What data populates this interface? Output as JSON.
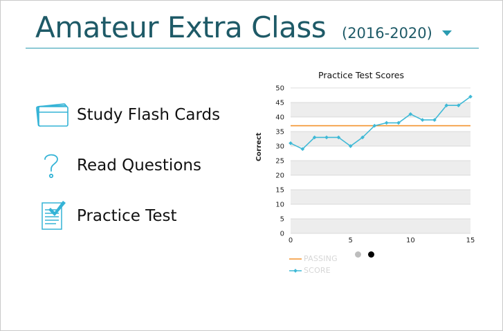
{
  "header": {
    "title": "Amateur Extra Class",
    "subtitle": "(2016-2020)",
    "dropdown_icon": "caret-down-icon",
    "accent_color": "#2a9bb0",
    "title_color": "#1e5a67"
  },
  "menu": {
    "items": [
      {
        "label": "Study Flash Cards",
        "icon": "flash-cards-icon"
      },
      {
        "label": "Read Questions",
        "icon": "question-mark-icon"
      },
      {
        "label": "Practice Test",
        "icon": "test-checklist-icon"
      }
    ],
    "icon_color": "#34b3d6"
  },
  "chart_data": {
    "type": "line",
    "title": "Practice Test Scores",
    "xlabel": "",
    "ylabel": "Correct",
    "xlim": [
      0,
      15
    ],
    "ylim": [
      0,
      50
    ],
    "x_ticks": [
      0,
      5,
      10,
      15
    ],
    "y_ticks": [
      0,
      5,
      10,
      15,
      20,
      25,
      30,
      35,
      40,
      45,
      50
    ],
    "grid": "horizontal alternating bands",
    "legend_position": "bottom-left",
    "series": [
      {
        "name": "PASSING",
        "color": "#f3922b",
        "x": [
          0,
          15
        ],
        "values": [
          37,
          37
        ]
      },
      {
        "name": "SCORE",
        "color": "#3fb9d6",
        "x": [
          0,
          1,
          2,
          3,
          4,
          5,
          6,
          7,
          8,
          9,
          10,
          11,
          12,
          13,
          14,
          15
        ],
        "values": [
          31,
          29,
          33,
          33,
          33,
          30,
          33,
          37,
          38,
          38,
          41,
          39,
          39,
          44,
          44,
          47
        ]
      }
    ]
  },
  "pager": {
    "pages": 2,
    "active_index": 1,
    "inactive_color": "#bdbdbd",
    "active_color": "#000000"
  }
}
